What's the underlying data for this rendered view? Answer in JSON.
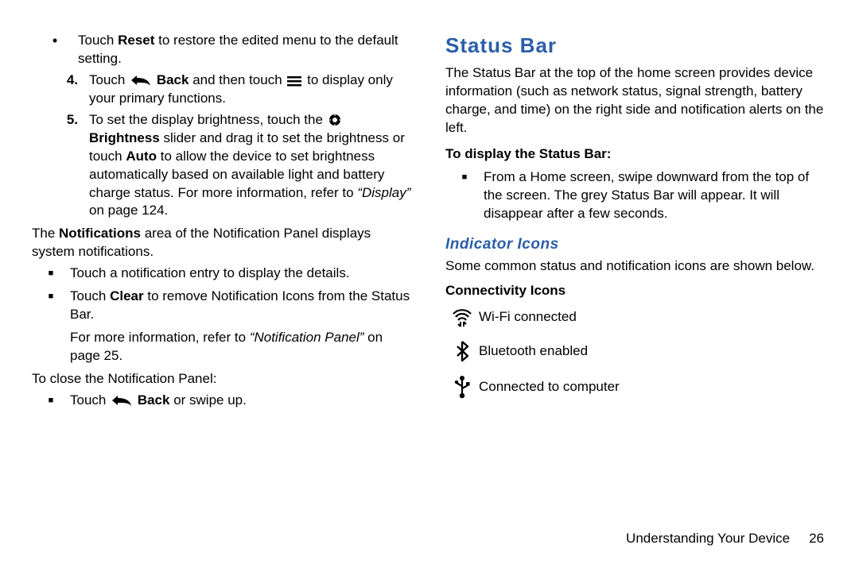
{
  "left": {
    "bullet_reset": {
      "pre": "Touch ",
      "bold": "Reset",
      "post": " to restore the edited menu to the default setting."
    },
    "step4": {
      "num": "4.",
      "a": "Touch ",
      "back": "Back",
      "b": " and then touch ",
      "c": " to display only your primary functions."
    },
    "step5": {
      "num": "5.",
      "a": "To set the display brightness, touch the ",
      "bright": "Brightness",
      "b": " slider and drag it to set the brightness or touch ",
      "auto": "Auto",
      "c": " to allow the device to set brightness automatically based on available light and battery charge status. For more information, refer to ",
      "ref": "“Display”",
      "d": " on page 124."
    },
    "notif_area": {
      "a": "The ",
      "b": "Notifications",
      "c": " area of the Notification Panel displays system notifications."
    },
    "touch_details": "Touch a notification entry to display the details.",
    "clear": {
      "a": "Touch ",
      "b": "Clear",
      "c": " to remove Notification Icons from the Status Bar."
    },
    "more_info": {
      "a": "For more information, refer to ",
      "ref": "“Notification Panel”",
      "b": " on page 25."
    },
    "close_panel": "To close the Notification Panel:",
    "back_swipe": {
      "a": "Touch ",
      "back": "Back",
      "b": " or swipe up."
    }
  },
  "right": {
    "h1": "Status Bar",
    "intro": "The Status Bar at the top of the home screen provides device information (such as network status, signal strength, battery charge, and time) on the right side and notification alerts on the left.",
    "to_display_h": "To display the Status Bar:",
    "to_display_b": "From a Home screen, swipe downward from the top of the screen. The grey Status Bar will appear. It will disappear after a few seconds.",
    "h2": "Indicator Icons",
    "ind_intro": "Some common status and notification icons are shown below.",
    "conn_h": "Connectivity Icons",
    "conn": {
      "wifi": "Wi-Fi connected",
      "bt": "Bluetooth enabled",
      "usb": "Connected to computer"
    }
  },
  "footer": {
    "section": "Understanding Your Device",
    "page": "26"
  }
}
